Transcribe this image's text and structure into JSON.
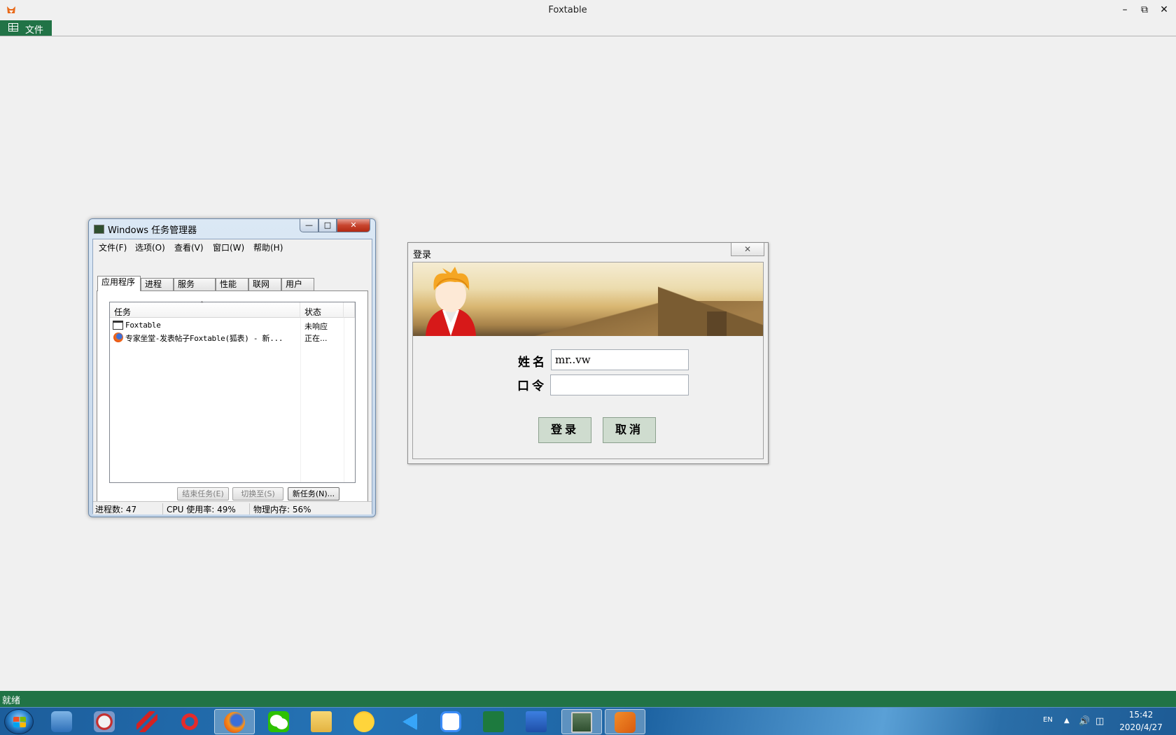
{
  "app": {
    "title": "Foxtable",
    "file_tab": "文件",
    "status": "就绪",
    "window_buttons": [
      "minimize-icon",
      "restore-icon",
      "close-icon"
    ]
  },
  "task_manager": {
    "title": "Windows 任务管理器",
    "menu": [
      "文件(F)",
      "选项(O)",
      "查看(V)",
      "窗口(W)",
      "帮助(H)"
    ],
    "tabs": [
      "应用程序",
      "进程",
      "服务",
      "性能",
      "联网",
      "用户"
    ],
    "selected_tab": "应用程序",
    "columns": [
      "任务",
      "状态"
    ],
    "rows": [
      {
        "name": "Foxtable",
        "status": "未响应"
      },
      {
        "name": "专家坐堂-发表帖子Foxtable(狐表) - 新...",
        "status": "正在..."
      }
    ],
    "buttons": [
      "结束任务(E)",
      "切换至(S)",
      "新任务(N)..."
    ],
    "status": [
      "进程数: 47",
      "CPU 使用率: 49%",
      "物理内存: 56%"
    ]
  },
  "login": {
    "title": "登录",
    "name_label": "姓名",
    "name_value": "mr..vw",
    "password_label": "口令",
    "password_value": "",
    "login_button": "登录",
    "cancel_button": "取消"
  },
  "taskbar": {
    "apps": [
      "network-app",
      "remote-desktop-app",
      "red-app",
      "ribbon-app",
      "firefox-app",
      "wechat-app",
      "file-explorer-app",
      "ftp-app",
      "media-player-app",
      "baidu-netdisk-app",
      "excel-app",
      "v4-app",
      "task-manager-app",
      "foxtable-app"
    ],
    "active_apps": [
      "firefox-app",
      "task-manager-app",
      "foxtable-app"
    ],
    "tray_lang": "EN",
    "time": "15:42",
    "date": "2020/4/27"
  }
}
